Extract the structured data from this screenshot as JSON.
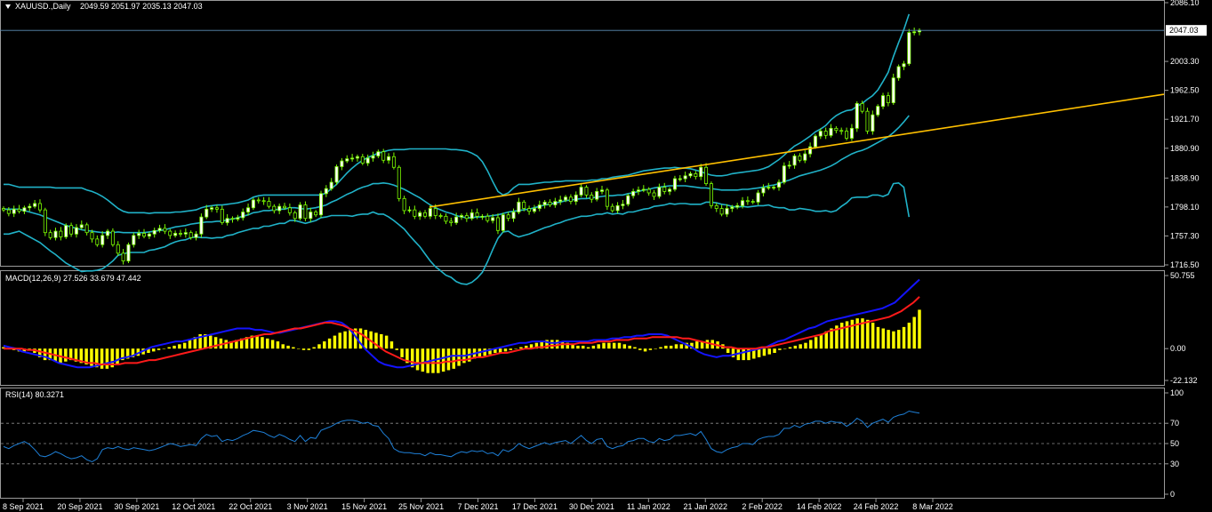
{
  "header": {
    "menu_icon": "triangle-down-icon",
    "symbol": "XAUUSD.,Daily",
    "ohlc": "2049.59 2051.97 2035.13 2047.03"
  },
  "macd_label": "MACD(12,26,9) 27.526 33.679 47.442",
  "rsi_label": "RSI(14) 80.3271",
  "colors": {
    "background": "#000000",
    "bull_candle": "#ffffff",
    "bear_candle": "#000000",
    "wick": "#7cfc00",
    "bollinger": "#20b2c8",
    "trendline": "#ffc000",
    "price_line": "#5d8fb8",
    "macd_hist": "#ffff00",
    "macd_line": "#1414ff",
    "signal_line": "#ff1a1a",
    "rsi_line": "#1e7fd6"
  },
  "chart_data": [
    {
      "type": "candlestick",
      "symbol": "XAUUSD.",
      "timeframe": "Daily",
      "title": "XAUUSD.,Daily",
      "last_price": "2047.03",
      "y_ticks": [
        "2086.10",
        "2047.03",
        "2003.30",
        "1962.50",
        "1921.70",
        "1880.90",
        "1838.90",
        "1798.10",
        "1757.30",
        "1716.50"
      ],
      "ylim": [
        1716.5,
        2086.1
      ],
      "x_ticks": [
        "8 Sep 2021",
        "20 Sep 2021",
        "30 Sep 2021",
        "12 Oct 2021",
        "22 Oct 2021",
        "3 Nov 2021",
        "15 Nov 2021",
        "25 Nov 2021",
        "7 Dec 2021",
        "17 Dec 2021",
        "30 Dec 2021",
        "11 Jan 2022",
        "21 Jan 2022",
        "2 Feb 2022",
        "14 Feb 2022",
        "24 Feb 2022",
        "8 Mar 2022"
      ],
      "close": [
        1794,
        1789,
        1795,
        1792,
        1797,
        1799,
        1803,
        1794,
        1762,
        1755,
        1764,
        1756,
        1772,
        1760,
        1769,
        1773,
        1762,
        1753,
        1745,
        1758,
        1764,
        1745,
        1733,
        1722,
        1745,
        1758,
        1761,
        1757,
        1760,
        1765,
        1768,
        1764,
        1758,
        1761,
        1760,
        1762,
        1755,
        1760,
        1784,
        1795,
        1797,
        1795,
        1776,
        1782,
        1781,
        1783,
        1791,
        1797,
        1808,
        1807,
        1806,
        1799,
        1793,
        1799,
        1797,
        1790,
        1782,
        1801,
        1782,
        1791,
        1787,
        1817,
        1824,
        1833,
        1855,
        1863,
        1866,
        1867,
        1869,
        1860,
        1867,
        1870,
        1876,
        1864,
        1869,
        1854,
        1810,
        1793,
        1794,
        1785,
        1790,
        1785,
        1796,
        1786,
        1785,
        1778,
        1776,
        1784,
        1786,
        1782,
        1790,
        1785,
        1785,
        1779,
        1783,
        1765,
        1787,
        1782,
        1791,
        1805,
        1796,
        1792,
        1796,
        1801,
        1805,
        1801,
        1806,
        1808,
        1812,
        1806,
        1815,
        1826,
        1815,
        1809,
        1820,
        1822,
        1799,
        1793,
        1800,
        1802,
        1814,
        1820,
        1822,
        1823,
        1818,
        1813,
        1826,
        1820,
        1823,
        1838,
        1838,
        1842,
        1845,
        1841,
        1854,
        1831,
        1800,
        1796,
        1788,
        1796,
        1798,
        1800,
        1807,
        1806,
        1805,
        1818,
        1825,
        1826,
        1826,
        1833,
        1856,
        1857,
        1870,
        1864,
        1873,
        1883,
        1898,
        1905,
        1899,
        1909,
        1906,
        1905,
        1895,
        1909,
        1944,
        1933,
        1905,
        1928,
        1940,
        1955,
        1945,
        1980,
        1996,
        2000,
        2044,
        2045,
        2047
      ],
      "bollinger_upper": [
        1830,
        1830,
        1828,
        1826,
        1826,
        1826,
        1826,
        1826,
        1826,
        1826,
        1825,
        1825,
        1825,
        1825,
        1825,
        1825,
        1822,
        1820,
        1817,
        1813,
        1808,
        1802,
        1796,
        1792,
        1790,
        1790,
        1790,
        1790,
        1789,
        1790,
        1790,
        1790,
        1790,
        1791,
        1791,
        1792,
        1793,
        1794,
        1797,
        1799,
        1800,
        1801,
        1801,
        1802,
        1803,
        1804,
        1806,
        1808,
        1812,
        1814,
        1815,
        1815,
        1815,
        1815,
        1815,
        1815,
        1815,
        1815,
        1815,
        1815,
        1815,
        1815,
        1818,
        1824,
        1830,
        1838,
        1846,
        1853,
        1859,
        1864,
        1868,
        1871,
        1874,
        1876,
        1878,
        1879,
        1879,
        1879,
        1880,
        1880,
        1880,
        1880,
        1880,
        1880,
        1880,
        1880,
        1879,
        1879,
        1878,
        1877,
        1874,
        1870,
        1862,
        1849,
        1834,
        1820,
        1815,
        1818,
        1825,
        1830,
        1830,
        1830,
        1831,
        1832,
        1833,
        1833,
        1834,
        1834,
        1835,
        1835,
        1835,
        1835,
        1835,
        1836,
        1836,
        1838,
        1838,
        1840,
        1841,
        1842,
        1843,
        1845,
        1847,
        1849,
        1850,
        1851,
        1852,
        1853,
        1853,
        1854,
        1853,
        1853,
        1852,
        1850,
        1848,
        1845,
        1843,
        1842,
        1842,
        1843,
        1845,
        1846,
        1847,
        1848,
        1849,
        1850,
        1852,
        1855,
        1860,
        1865,
        1871,
        1878,
        1884,
        1888,
        1893,
        1898,
        1904,
        1908,
        1913,
        1921,
        1927,
        1931,
        1934,
        1935,
        1940,
        1944,
        1950,
        1955,
        1963,
        1975,
        1988,
        2010,
        2030,
        2048,
        2070
      ],
      "bollinger_middle": [
        1795,
        1795,
        1795,
        1795,
        1793,
        1791,
        1789,
        1787,
        1784,
        1781,
        1778,
        1775,
        1772,
        1770,
        1768,
        1766,
        1765,
        1764,
        1763,
        1762,
        1762,
        1762,
        1763,
        1762,
        1762,
        1762,
        1762,
        1762,
        1763,
        1764,
        1765,
        1766,
        1768,
        1770,
        1771,
        1772,
        1774,
        1775,
        1776,
        1777,
        1777,
        1778,
        1778,
        1780,
        1781,
        1783,
        1785,
        1787,
        1790,
        1791,
        1793,
        1793,
        1794,
        1795,
        1795,
        1797,
        1797,
        1796,
        1795,
        1796,
        1797,
        1799,
        1801,
        1805,
        1808,
        1812,
        1816,
        1819,
        1823,
        1826,
        1828,
        1831,
        1831,
        1832,
        1831,
        1829,
        1826,
        1823,
        1819,
        1815,
        1811,
        1806,
        1801,
        1797,
        1794,
        1791,
        1789,
        1786,
        1784,
        1783,
        1783,
        1784,
        1784,
        1785,
        1786,
        1787,
        1789,
        1791,
        1792,
        1793,
        1794,
        1795,
        1797,
        1799,
        1801,
        1802,
        1804,
        1805,
        1807,
        1808,
        1809,
        1810,
        1810,
        1811,
        1812,
        1813,
        1814,
        1814,
        1815,
        1815,
        1817,
        1818,
        1820,
        1822,
        1823,
        1825,
        1826,
        1827,
        1828,
        1828,
        1828,
        1828,
        1827,
        1826,
        1825,
        1825,
        1824,
        1823,
        1822,
        1822,
        1822,
        1822,
        1823,
        1823,
        1824,
        1825,
        1826,
        1828,
        1829,
        1831,
        1834,
        1836,
        1839,
        1842,
        1844,
        1846,
        1848,
        1850,
        1853,
        1856,
        1860,
        1865,
        1869,
        1873,
        1876,
        1878,
        1881,
        1885,
        1889,
        1893,
        1897,
        1903,
        1910,
        1918,
        1927
      ],
      "bollinger_lower": [
        1760,
        1760,
        1762,
        1764,
        1760,
        1756,
        1752,
        1748,
        1742,
        1736,
        1731,
        1725,
        1719,
        1715,
        1711,
        1707,
        1708,
        1708,
        1709,
        1711,
        1716,
        1722,
        1730,
        1732,
        1734,
        1734,
        1734,
        1734,
        1737,
        1738,
        1740,
        1742,
        1746,
        1749,
        1751,
        1752,
        1755,
        1756,
        1755,
        1755,
        1754,
        1755,
        1755,
        1758,
        1759,
        1762,
        1764,
        1766,
        1768,
        1768,
        1771,
        1771,
        1773,
        1775,
        1775,
        1779,
        1779,
        1777,
        1775,
        1777,
        1779,
        1783,
        1784,
        1786,
        1786,
        1786,
        1786,
        1785,
        1787,
        1788,
        1788,
        1791,
        1788,
        1788,
        1784,
        1779,
        1773,
        1767,
        1758,
        1750,
        1742,
        1732,
        1722,
        1714,
        1708,
        1702,
        1699,
        1693,
        1690,
        1689,
        1692,
        1698,
        1706,
        1721,
        1738,
        1754,
        1763,
        1764,
        1759,
        1756,
        1758,
        1760,
        1763,
        1766,
        1769,
        1771,
        1774,
        1776,
        1779,
        1781,
        1783,
        1785,
        1785,
        1786,
        1788,
        1788,
        1790,
        1788,
        1789,
        1788,
        1791,
        1791,
        1793,
        1795,
        1796,
        1799,
        1800,
        1801,
        1803,
        1802,
        1803,
        1803,
        1802,
        1802,
        1802,
        1805,
        1805,
        1804,
        1802,
        1801,
        1799,
        1798,
        1799,
        1798,
        1799,
        1800,
        1800,
        1801,
        1798,
        1797,
        1797,
        1794,
        1794,
        1796,
        1795,
        1794,
        1792,
        1792,
        1793,
        1791,
        1793,
        1799,
        1804,
        1811,
        1812,
        1812,
        1812,
        1815,
        1815,
        1813,
        1816,
        1831,
        1832,
        1826,
        1784
      ],
      "trendline": {
        "start": {
          "x": "Nov 2021",
          "y": 1798
        },
        "end": {
          "x": "beyond 8 Mar 2022",
          "y": 1957
        }
      }
    },
    {
      "type": "bar+line",
      "title": "MACD(12,26,9)",
      "y_ticks": [
        "50.755",
        "0.00",
        "-22.132"
      ],
      "ylim": [
        -22.132,
        50.755
      ],
      "histogram": [
        1,
        0,
        -1,
        -2,
        -2,
        -1,
        -3,
        -6,
        -8,
        -8,
        -9,
        -10,
        -9,
        -8,
        -9,
        -10,
        -11,
        -12,
        -13,
        -14,
        -14,
        -13,
        -11,
        -8,
        -7,
        -6,
        -5,
        -4,
        -3,
        -2,
        -1,
        0,
        1,
        2,
        3,
        4,
        6,
        8,
        10,
        10,
        9,
        8,
        7,
        6,
        5,
        6,
        7,
        8,
        9,
        9,
        8,
        7,
        6,
        5,
        3,
        2,
        1,
        0,
        -1,
        -1,
        1,
        3,
        5,
        7,
        9,
        11,
        12,
        13,
        14,
        14,
        13,
        12,
        11,
        10,
        9,
        5,
        -1,
        -6,
        -10,
        -13,
        -15,
        -16,
        -17,
        -17,
        -17,
        -16,
        -15,
        -14,
        -12,
        -10,
        -9,
        -7,
        -6,
        -5,
        -4,
        -3,
        -3,
        -2,
        -1,
        0,
        1,
        2,
        3,
        4,
        5,
        6,
        6,
        6,
        5,
        4,
        3,
        2,
        2,
        1,
        2,
        3,
        4,
        4,
        4,
        4,
        3,
        2,
        1,
        -1,
        -2,
        -1,
        0,
        1,
        2,
        2,
        3,
        3,
        4,
        4,
        5,
        5,
        6,
        6,
        5,
        3,
        -3,
        -6,
        -8,
        -8,
        -8,
        -7,
        -6,
        -5,
        -4,
        -3,
        -1,
        0,
        1,
        2,
        3,
        4,
        6,
        8,
        10,
        12,
        14,
        16,
        18,
        19,
        20,
        21,
        21,
        20,
        18,
        15,
        14,
        13,
        12,
        13,
        15,
        18,
        22,
        27
      ],
      "macd": [
        2,
        1,
        0,
        -2,
        -3,
        -4,
        -5,
        -6,
        -8,
        -10,
        -11,
        -12,
        -13,
        -13,
        -13,
        -12,
        -11,
        -10,
        -9,
        -7,
        -6,
        -5,
        -3,
        -1,
        1,
        2,
        3,
        4,
        5,
        5,
        6,
        7,
        8,
        9,
        10,
        11,
        12,
        13,
        14,
        14,
        14,
        13,
        13,
        12,
        11,
        11,
        12,
        13,
        14,
        15,
        16,
        17,
        18,
        19,
        19,
        18,
        15,
        10,
        4,
        -1,
        -5,
        -9,
        -11,
        -12,
        -13,
        -13,
        -12,
        -11,
        -10,
        -9,
        -8,
        -7,
        -6,
        -5,
        -5,
        -5,
        -4,
        -3,
        -2,
        -1,
        0,
        1,
        2,
        3,
        4,
        4,
        5,
        5,
        5,
        4,
        4,
        5,
        5,
        5,
        5,
        5,
        6,
        6,
        6,
        7,
        7,
        8,
        8,
        9,
        9,
        10,
        10,
        10,
        9,
        7,
        5,
        3,
        1,
        -2,
        -4,
        -5,
        -6,
        -5,
        -5,
        -4,
        -3,
        -2,
        -1,
        0,
        1,
        3,
        5,
        6,
        8,
        10,
        12,
        14,
        15,
        17,
        19,
        20,
        21,
        22,
        23,
        24,
        25,
        26,
        27,
        28,
        30,
        32,
        36,
        40,
        44,
        48
      ],
      "signal": [
        0,
        0,
        0,
        0,
        -1,
        -1,
        -2,
        -3,
        -4,
        -5,
        -6,
        -7,
        -8,
        -9,
        -10,
        -10,
        -11,
        -11,
        -11,
        -11,
        -10,
        -10,
        -10,
        -9,
        -8,
        -8,
        -7,
        -6,
        -5,
        -4,
        -3,
        -2,
        -1,
        0,
        1,
        2,
        3,
        4,
        5,
        6,
        7,
        8,
        9,
        10,
        10,
        11,
        12,
        13,
        14,
        14,
        15,
        16,
        17,
        18,
        18,
        17,
        16,
        14,
        12,
        10,
        7,
        4,
        1,
        -2,
        -4,
        -6,
        -8,
        -9,
        -10,
        -10,
        -10,
        -10,
        -10,
        -9,
        -9,
        -8,
        -8,
        -7,
        -6,
        -6,
        -5,
        -4,
        -3,
        -3,
        -2,
        -1,
        0,
        0,
        1,
        1,
        2,
        2,
        3,
        3,
        3,
        4,
        4,
        4,
        5,
        5,
        5,
        6,
        6,
        6,
        7,
        7,
        7,
        8,
        8,
        8,
        8,
        8,
        7,
        7,
        6,
        5,
        4,
        3,
        2,
        1,
        1,
        0,
        0,
        0,
        0,
        1,
        1,
        2,
        3,
        4,
        5,
        6,
        7,
        8,
        9,
        10,
        12,
        13,
        14,
        15,
        16,
        17,
        18,
        19,
        20,
        21,
        22,
        24,
        26,
        29,
        32,
        36
      ]
    },
    {
      "type": "line",
      "title": "RSI(14)",
      "y_ticks": [
        "100",
        "70",
        "50",
        "30",
        "0"
      ],
      "ylim": [
        0,
        100
      ],
      "levels": [
        70,
        50,
        30
      ],
      "values": [
        47,
        45,
        48,
        50,
        52,
        49,
        44,
        38,
        37,
        39,
        42,
        40,
        37,
        35,
        36,
        38,
        34,
        32,
        35,
        44,
        46,
        45,
        47,
        45,
        44,
        46,
        45,
        44,
        43,
        44,
        46,
        48,
        50,
        49,
        47,
        48,
        49,
        48,
        55,
        59,
        57,
        58,
        52,
        54,
        53,
        55,
        58,
        60,
        63,
        62,
        61,
        58,
        56,
        59,
        57,
        54,
        52,
        58,
        52,
        56,
        55,
        63,
        65,
        67,
        70,
        72,
        73,
        73,
        72,
        70,
        71,
        68,
        67,
        60,
        55,
        45,
        42,
        41,
        41,
        40,
        40,
        38,
        41,
        39,
        39,
        38,
        37,
        40,
        42,
        41,
        43,
        42,
        43,
        40,
        41,
        38,
        44,
        42,
        45,
        50,
        47,
        45,
        47,
        49,
        51,
        49,
        51,
        52,
        53,
        50,
        54,
        58,
        53,
        50,
        54,
        55,
        47,
        45,
        47,
        48,
        52,
        53,
        55,
        55,
        52,
        51,
        55,
        53,
        54,
        58,
        58,
        59,
        60,
        58,
        62,
        54,
        45,
        42,
        41,
        44,
        46,
        47,
        50,
        50,
        49,
        54,
        56,
        57,
        57,
        59,
        65,
        65,
        68,
        66,
        69,
        70,
        72,
        72,
        70,
        72,
        71,
        71,
        67,
        70,
        75,
        72,
        66,
        70,
        72,
        74,
        71,
        76,
        78,
        79,
        82,
        81,
        80
      ]
    }
  ]
}
